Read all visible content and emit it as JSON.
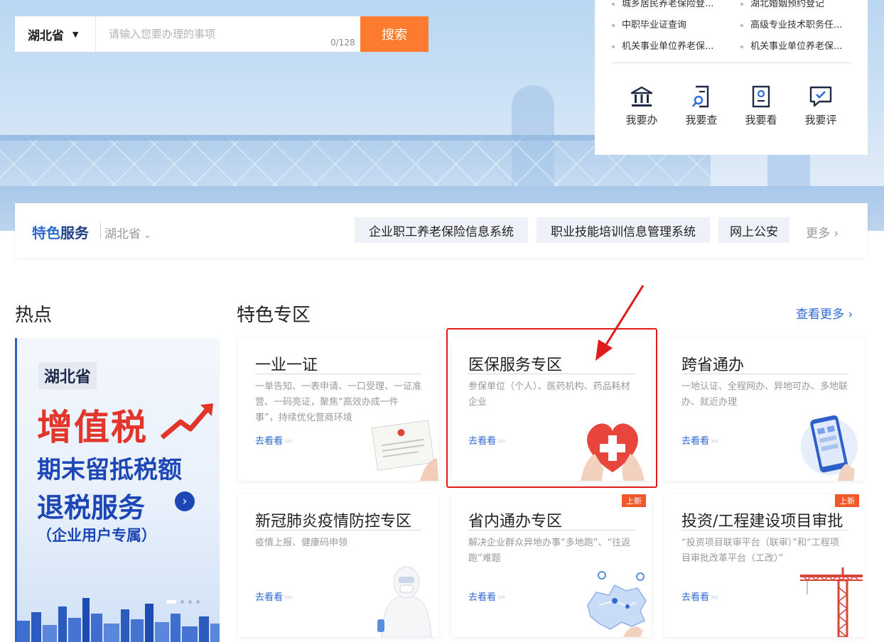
{
  "search": {
    "province": "湖北省",
    "placeholder": "请输入您要办理的事项",
    "counter": "0/128",
    "button": "搜索"
  },
  "panel": {
    "items": [
      {
        "label": "城乡居民养老保险登..."
      },
      {
        "label": "湖北婚姻预约登记"
      },
      {
        "label": "中职毕业证查询"
      },
      {
        "label": "高级专业技术职务任..."
      },
      {
        "label": "机关事业单位养老保..."
      },
      {
        "label": "机关事业单位养老保..."
      }
    ],
    "actions": [
      {
        "label": "我要办",
        "icon": "bank-icon"
      },
      {
        "label": "我要查",
        "icon": "search-doc-icon"
      },
      {
        "label": "我要看",
        "icon": "view-doc-icon"
      },
      {
        "label": "我要评",
        "icon": "comment-check-icon"
      }
    ]
  },
  "features": {
    "title_a": "特色",
    "title_b": "服务",
    "region": "湖北省",
    "tags": [
      "企业职工养老保险信息系统",
      "职业技能培训信息管理系统",
      "网上公安"
    ],
    "more": "更多 ›"
  },
  "sections": {
    "hot": "热点",
    "zone": "特色专区",
    "view_more": "查看更多 ›"
  },
  "banner": {
    "province": "湖北省",
    "line1": "增值税",
    "line2": "期末留抵税额",
    "line3": "退税服务",
    "line4": "（企业用户专属）"
  },
  "cards": [
    {
      "title": "一业一证",
      "desc": "一单告知、一表申请、一口受理、一证准营、一码亮证，聚焦“高效办成一件事”，持续优化营商环境",
      "go": "去看看",
      "badge": ""
    },
    {
      "title": "医保服务专区",
      "desc": "参保单位（个人）、医药机构、药品耗材企业",
      "go": "去看看",
      "badge": ""
    },
    {
      "title": "跨省通办",
      "desc": "一地认证、全程网办、异地可办、多地联办、就近办理",
      "go": "去看看",
      "badge": ""
    },
    {
      "title": "新冠肺炎疫情防控专区",
      "desc": "疫情上报、健康码申领",
      "go": "去看看",
      "badge": ""
    },
    {
      "title": "省内通办专区",
      "desc": "解决企业群众异地办事“多地跑”、“往返跑”难题",
      "go": "去看看",
      "badge": "上新"
    },
    {
      "title": "投资/工程建设项目审批",
      "desc": "“投资项目联审平台（联审）”和“工程项目审批改革平台（工改）”",
      "go": "去看看",
      "badge": "上新"
    }
  ],
  "colors": {
    "accent": "#2f6bd4",
    "search_button": "#fd7b2e",
    "badge": "#f0582a",
    "highlight": "#e01b1b"
  }
}
